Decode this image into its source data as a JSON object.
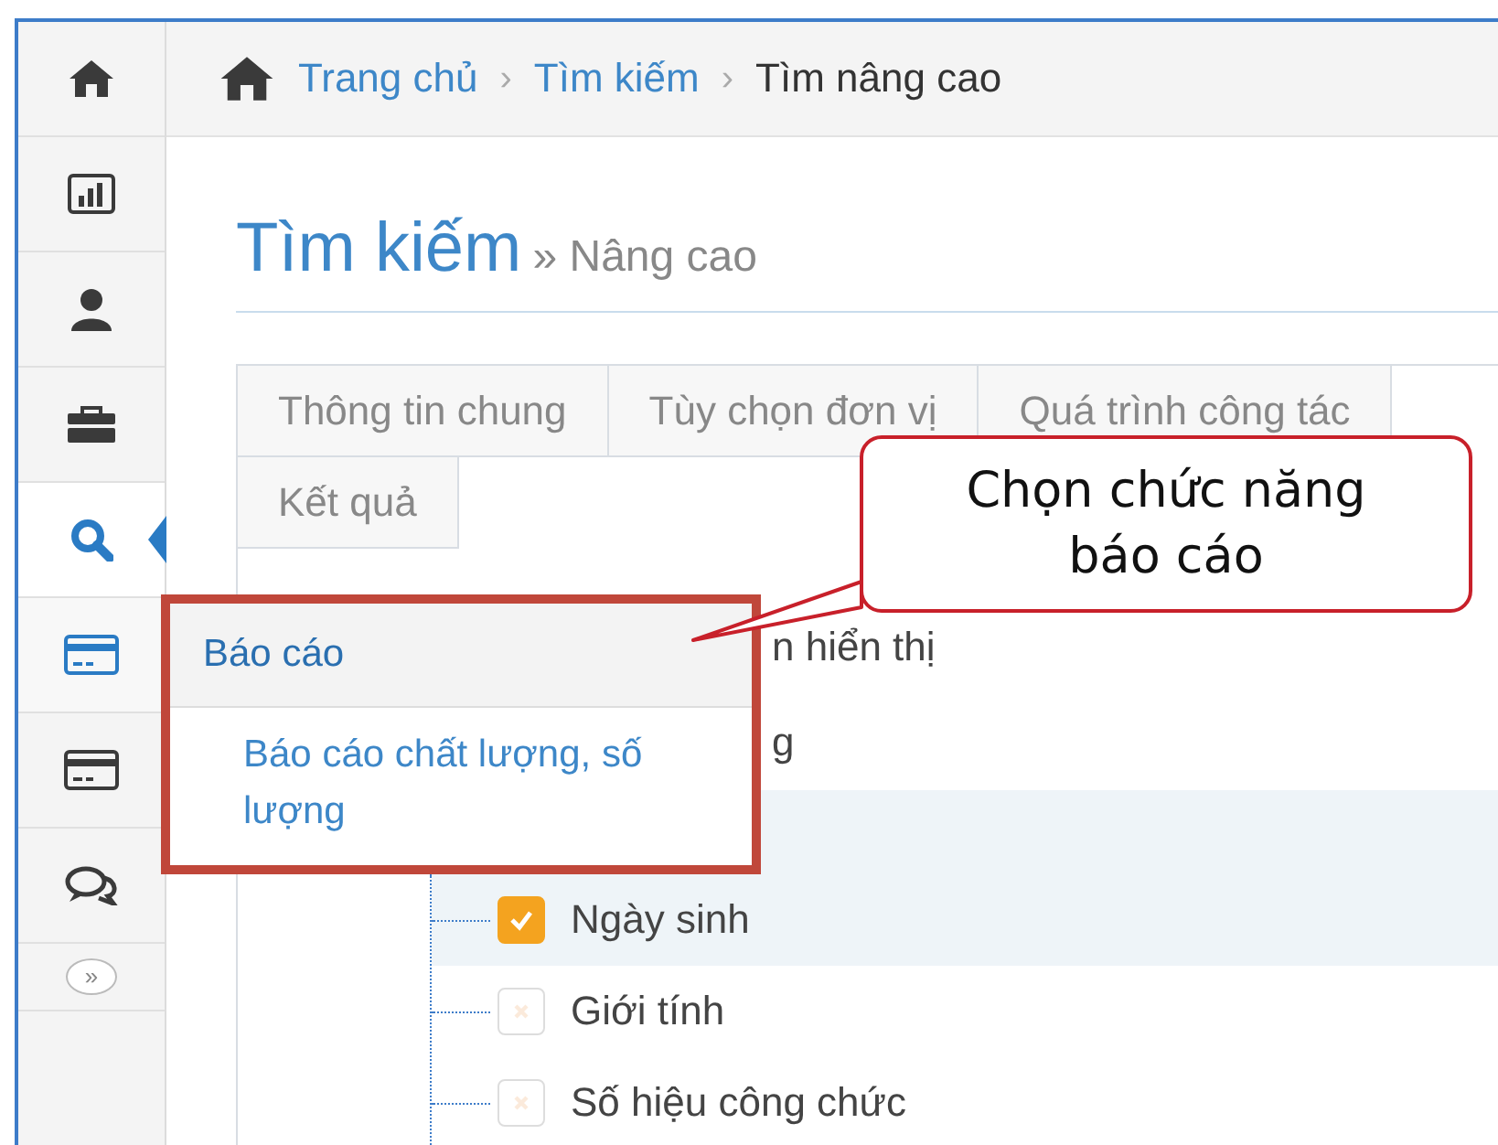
{
  "sidebar": {
    "items": [
      {
        "kind": "home",
        "selected": false,
        "open": false
      },
      {
        "kind": "chart",
        "selected": false,
        "open": false
      },
      {
        "kind": "user",
        "selected": false,
        "open": false
      },
      {
        "kind": "briefcase",
        "selected": false,
        "open": false
      },
      {
        "kind": "search",
        "selected": true,
        "open": false
      },
      {
        "kind": "card",
        "selected": false,
        "open": true
      },
      {
        "kind": "card",
        "selected": false,
        "open": false
      },
      {
        "kind": "chat",
        "selected": false,
        "open": false
      }
    ],
    "expand_button": "»"
  },
  "breadcrumb": [
    {
      "label": "Trang chủ",
      "link": true
    },
    {
      "separator": "›",
      "label": "Tìm kiếm",
      "link": true
    },
    {
      "separator": "›",
      "label": "Tìm nâng cao",
      "link": false
    }
  ],
  "page_title": {
    "title": "Tìm kiếm",
    "subtitle": "» Nâng cao"
  },
  "tabs": [
    {
      "label": "Thông tin chung",
      "selected": false
    },
    {
      "label": "Tùy chọn đơn vị",
      "selected": false
    },
    {
      "label": "Quá trình công tác",
      "selected": false
    },
    {
      "label": "Kết quả",
      "selected": false
    }
  ],
  "tree": {
    "partial_lines": [
      "n hiển thị",
      "g"
    ],
    "fields": [
      {
        "label": "Ngày sinh",
        "checked": true
      },
      {
        "label": "Giới tính",
        "checked": false
      },
      {
        "label": "Số hiệu công chức",
        "checked": false
      }
    ]
  },
  "popup_menu": {
    "header": "Báo cáo",
    "items": [
      "Báo cáo chất lượng, số lượng"
    ]
  },
  "callout": {
    "text": "Chọn chức năng báo cáo"
  }
}
